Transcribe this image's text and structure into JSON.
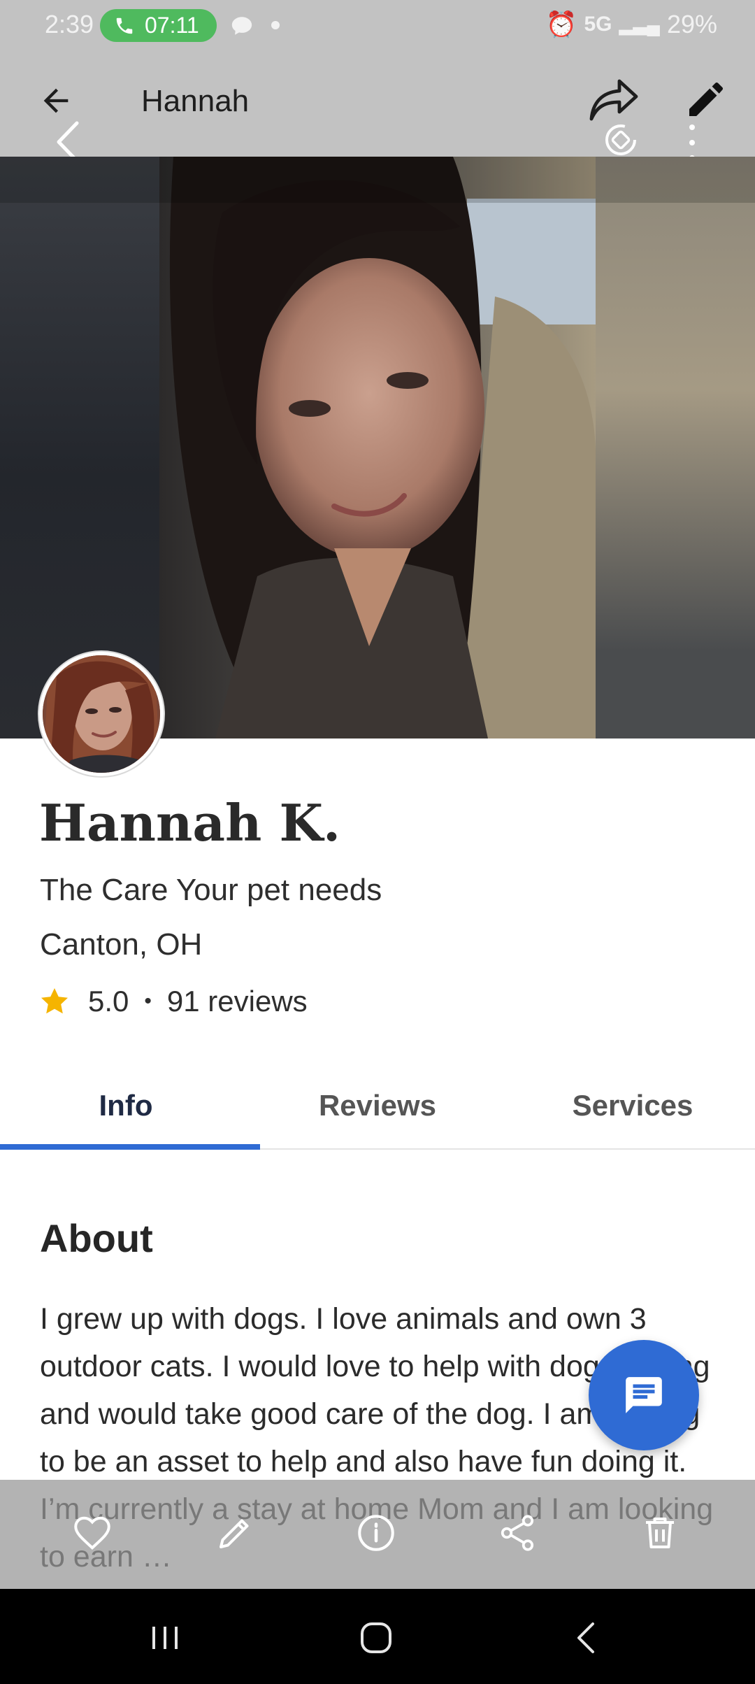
{
  "status_bar": {
    "time": "2:39",
    "call_duration": "07:11",
    "network": "5G",
    "battery": "29%"
  },
  "app_bar": {
    "title": "Hannah"
  },
  "profile": {
    "name": "Hannah K.",
    "tagline": "The Care Your pet needs",
    "location": "Canton, OH",
    "rating": "5.0",
    "separator": "•",
    "reviews": "91 reviews"
  },
  "tabs": [
    {
      "label": "Info",
      "active": true
    },
    {
      "label": "Reviews",
      "active": false
    },
    {
      "label": "Services",
      "active": false
    }
  ],
  "about": {
    "title": "About",
    "text": "I grew up with dogs. I love animals and own 3 outdoor cats. I would love to help with doggysitting and would take good care of the dog. I am hoping to be an asset to help and also have fun doing it. I’m currently a stay at home Mom and I am looking to earn …"
  },
  "icons": {
    "back": "arrow-left-icon",
    "share": "share-icon",
    "edit": "pencil-icon",
    "chat": "chat-icon",
    "favorite": "heart-icon",
    "trash": "trash-icon"
  },
  "colors": {
    "accent": "#2f6bd4",
    "call_pill": "#4fba5e",
    "star": "#f5b400",
    "bars": "#c2c2c2"
  }
}
